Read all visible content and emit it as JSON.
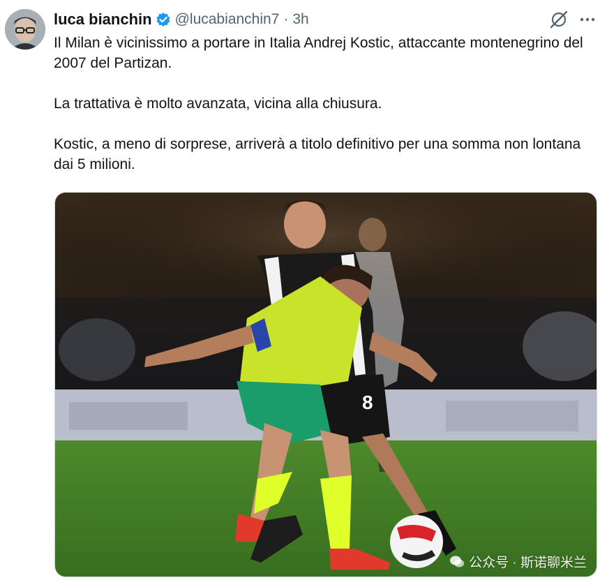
{
  "author": {
    "display_name": "luca bianchin",
    "handle": "@lucabianchin7",
    "separator": "·",
    "time": "3h",
    "verified": true,
    "avatar": "user-avatar-photo"
  },
  "actions": {
    "grok_icon": "grok-slash-circle-icon",
    "more_icon": "more-horizontal-icon"
  },
  "tweet": {
    "paragraphs": [
      "Il Milan è vicinissimo a portare in Italia Andrej Kostic, attaccante montenegrino del 2007 del Partizan.",
      "La trattativa è molto avanzata, vicina alla chiusura.",
      "Kostic, a meno di sorprese, arriverà a titolo definitivo per una somma non lontana dai 5 milioni."
    ]
  },
  "media": {
    "description": "football-match-photo",
    "watermark_text": "公众号 · 斯诺聊米兰",
    "player_number": "8"
  },
  "colors": {
    "verified": "#1d9bf0",
    "secondary_text": "#536471",
    "primary_text": "#0f1419"
  }
}
